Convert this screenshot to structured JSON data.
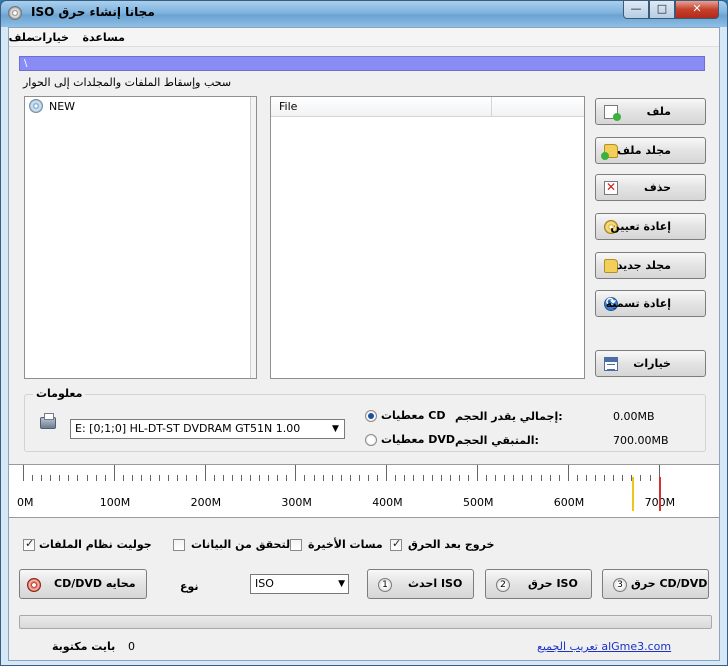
{
  "window": {
    "title": "ISO مجانا إنشاء حرق",
    "minimize_glyph": "—",
    "maximize_glyph": "□",
    "close_glyph": "✕"
  },
  "menu": {
    "items": [
      "ملف",
      "خيارات",
      "مساعدة"
    ]
  },
  "path_bar": {
    "value": "\\"
  },
  "drop_hint": "سحب وإسقاط الملفات والمجلدات إلى الحوار",
  "tree": {
    "root_label": "NEW"
  },
  "files": {
    "column_header": "File"
  },
  "side_buttons": [
    {
      "label": "ملف",
      "icon": "add-file-icon"
    },
    {
      "label": "مجلد ملف",
      "icon": "add-folder-icon"
    },
    {
      "label": "حذف",
      "icon": "delete-icon"
    },
    {
      "label": "إعادة تعيين",
      "icon": "reset-icon"
    },
    {
      "label": "مجلد جديد",
      "icon": "new-folder-icon"
    },
    {
      "label": "إعادة تسمية",
      "icon": "rename-icon"
    },
    {
      "label": "خيارات",
      "icon": "options-icon"
    }
  ],
  "info": {
    "legend": "معلومات",
    "drive": "E: [0;1;0] HL-DT-ST DVDRAM GT51N    1.00",
    "radio_cd": "معطيات CD",
    "radio_dvd": "معطيات DVD",
    "total_label": "إجمالي يقدر الحجم:",
    "total_value": "0.00MB",
    "remaining_label": "المتبقي الحجم:",
    "remaining_value": "700.00MB"
  },
  "ruler": {
    "labels": [
      "0M",
      "100M",
      "200M",
      "300M",
      "400M",
      "500M",
      "600M",
      "700M"
    ],
    "marker_yellow": "#f0c419",
    "marker_red": "#d8322c"
  },
  "options": {
    "joliet": "جوليت نظام الملفات",
    "verify": "التحقق من البيانات",
    "last_session": "مسات الأخيرة",
    "exit_after": "خروج بعد الحرق"
  },
  "actions": {
    "protect": "CD/DVD  محايه",
    "type_label": "نوع",
    "type_value": "ISO",
    "create_iso": "احدث ISO",
    "burn_iso": "حرق ISO",
    "burn_cd": "حرق CD/DVD",
    "badge1": "1",
    "badge2": "2",
    "badge3": "3"
  },
  "status": {
    "label": "بايت مكتوبة",
    "value": "0",
    "credit_link": "تعريب الجميع alGme3.com"
  }
}
